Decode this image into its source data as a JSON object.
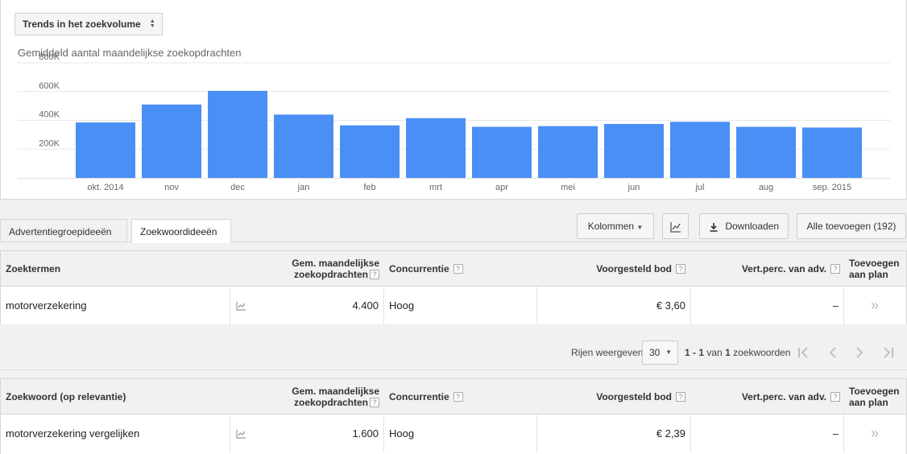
{
  "trend_select": {
    "label": "Trends in het zoekvolume"
  },
  "chart_title": "Gemiddeld aantal maandelijkse zoekopdrachten",
  "chart_data": {
    "type": "bar",
    "categories": [
      "okt. 2014",
      "nov",
      "dec",
      "jan",
      "feb",
      "mrt",
      "apr",
      "mei",
      "jun",
      "jul",
      "aug",
      "sep. 2015"
    ],
    "values": [
      385000,
      510000,
      605000,
      440000,
      365000,
      415000,
      355000,
      360000,
      375000,
      390000,
      355000,
      350000
    ],
    "ylim": [
      0,
      800000
    ],
    "yticks": [
      200000,
      400000,
      600000,
      800000
    ],
    "ytick_labels": [
      "200K",
      "400K",
      "600K",
      "800K"
    ],
    "bar_color": "#4a8ff5",
    "grid": true
  },
  "tabs": [
    {
      "label": "Advertentiegroepideeën"
    },
    {
      "label": "Zoekwoordideeën"
    }
  ],
  "toolbar": {
    "columns_label": "Kolommen",
    "download_label": "Downloaden",
    "add_all_label": "Alle toevoegen (192)"
  },
  "headers1": {
    "term": "Zoektermen",
    "volume_l1": "Gem. maandelijkse",
    "volume_l2": "zoekopdrachten",
    "competition": "Concurrentie",
    "bid": "Voorgesteld bod",
    "share": "Vert.perc. van adv.",
    "add_l1": "Toevoegen",
    "add_l2": "aan plan"
  },
  "row1": {
    "keyword": "motorverzekering",
    "volume": "4.400",
    "competition": "Hoog",
    "bid": "€ 3,60",
    "share": "–"
  },
  "pager": {
    "rows_label": "Rijen weergeven:",
    "rows_value": "30",
    "range": "1 - 1",
    "of": "van",
    "total": "1",
    "unit": "zoekwoorden"
  },
  "headers2": {
    "term": "Zoekwoord (op relevantie)",
    "volume_l1": "Gem. maandelijkse",
    "volume_l2": "zoekopdrachten",
    "competition": "Concurrentie",
    "bid": "Voorgesteld bod",
    "share": "Vert.perc. van adv.",
    "add_l1": "Toevoegen",
    "add_l2": "aan plan"
  },
  "row2": {
    "keyword": "motorverzekering vergelijken",
    "volume": "1.600",
    "competition": "Hoog",
    "bid": "€ 2,39",
    "share": "–"
  },
  "help_glyph": "?",
  "add_glyph": "»"
}
